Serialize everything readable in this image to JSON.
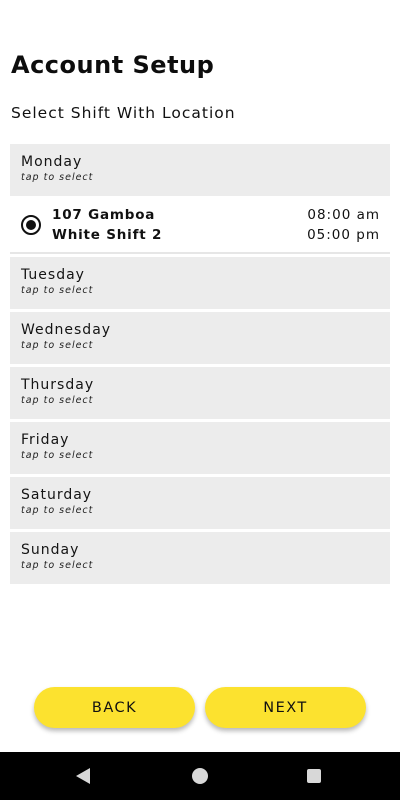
{
  "header": {
    "title": "Account Setup",
    "subtitle": "Select Shift With Location"
  },
  "days": [
    {
      "name": "Monday",
      "hint": "tap to select",
      "expanded": true,
      "shift": {
        "location": "107 Gamboa",
        "name": "White Shift 2",
        "start": "08:00 am",
        "end": "05:00 pm",
        "selected": true
      }
    },
    {
      "name": "Tuesday",
      "hint": "tap to select"
    },
    {
      "name": "Wednesday",
      "hint": "tap to select"
    },
    {
      "name": "Thursday",
      "hint": "tap to select"
    },
    {
      "name": "Friday",
      "hint": "tap to select"
    },
    {
      "name": "Saturday",
      "hint": "tap to select"
    },
    {
      "name": "Sunday",
      "hint": "tap to select"
    }
  ],
  "footer": {
    "back_label": "BACK",
    "next_label": "NEXT"
  },
  "theme": {
    "accent": "#fce22f",
    "row_background": "#ececec",
    "nav_bar": "#000000"
  },
  "system_nav": {
    "icons": [
      "back-triangle-icon",
      "home-circle-icon",
      "recents-square-icon"
    ]
  }
}
